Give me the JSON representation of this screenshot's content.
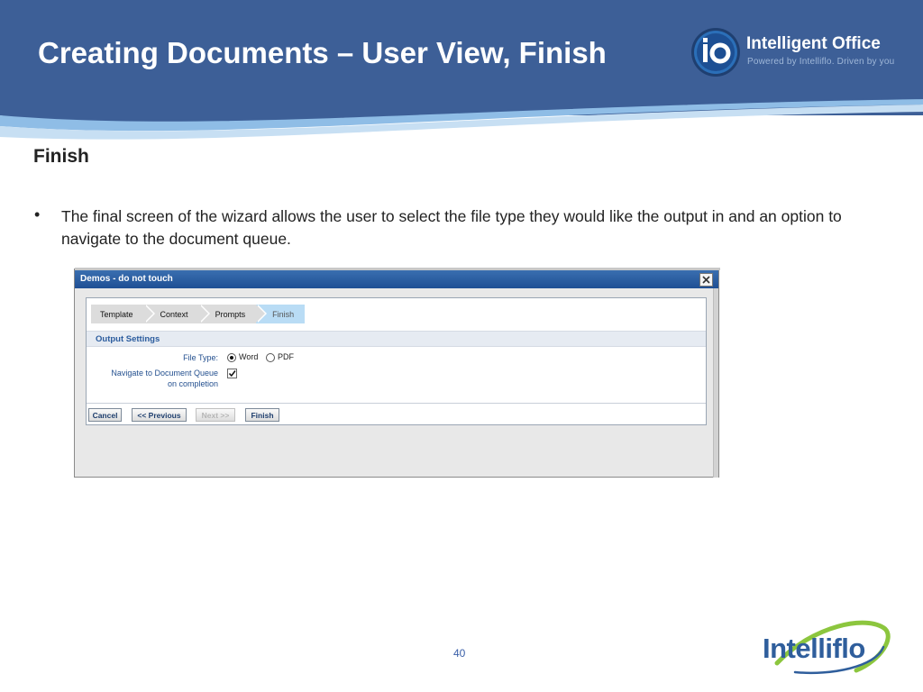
{
  "slide": {
    "title": "Creating Documents – User View, Finish",
    "section_heading": "Finish",
    "bullet_symbol": "•",
    "bullet_text": "The final screen of the wizard allows the user to select the file type they would like the output in and an option to navigate to the document queue.",
    "page_number": "40"
  },
  "branding": {
    "io_brand": "Intelligent Office",
    "io_tagline": "Powered by Intelliflo. Driven by you",
    "footer_logo": "Intelliflo"
  },
  "dialog": {
    "title": "Demos - do not touch",
    "close_icon": "close-icon",
    "wizard_steps": [
      {
        "label": "Template",
        "active": false
      },
      {
        "label": "Context",
        "active": false
      },
      {
        "label": "Prompts",
        "active": false
      },
      {
        "label": "Finish",
        "active": true
      }
    ],
    "section_label": "Output Settings",
    "file_type_label": "File Type:",
    "file_type_options": [
      {
        "label": "Word",
        "selected": true
      },
      {
        "label": "PDF",
        "selected": false
      }
    ],
    "navigate_label_line1": "Navigate to Document Queue",
    "navigate_label_line2": "on completion",
    "navigate_checked": true,
    "buttons": {
      "cancel": "Cancel",
      "previous": "<< Previous",
      "next": "Next >>",
      "finish": "Finish"
    }
  },
  "colors": {
    "header_blue": "#3c5f98",
    "accent_light_blue": "#8fbde6",
    "titlebar_blue": "#2a5ea3",
    "label_blue": "#24508f"
  }
}
